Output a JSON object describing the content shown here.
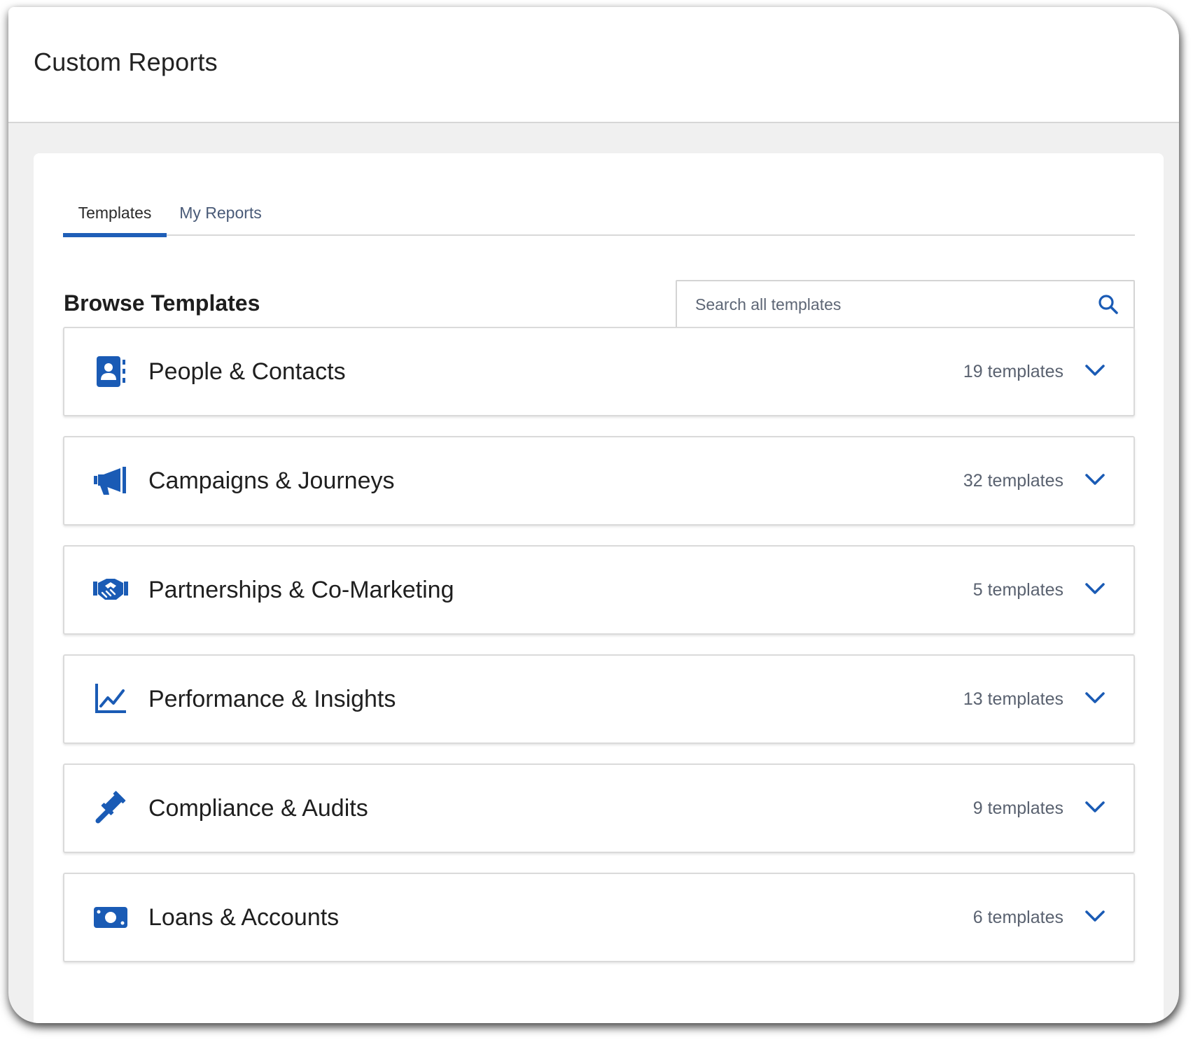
{
  "app": {
    "title": "Custom Reports"
  },
  "tabs": [
    {
      "label": "Templates",
      "active": true
    },
    {
      "label": "My Reports",
      "active": false
    }
  ],
  "browse": {
    "title": "Browse Templates",
    "search": {
      "placeholder": "Search all templates",
      "value": "",
      "icon": "search-icon"
    }
  },
  "categories": [
    {
      "label": "People & Contacts",
      "count": "19 templates",
      "icon": "contact-card-icon"
    },
    {
      "label": "Campaigns & Journeys",
      "count": "32 templates",
      "icon": "megaphone-icon"
    },
    {
      "label": "Partnerships & Co-Marketing",
      "count": "5 templates",
      "icon": "handshake-icon"
    },
    {
      "label": "Performance & Insights",
      "count": "13 templates",
      "icon": "line-chart-icon"
    },
    {
      "label": "Compliance & Audits",
      "count": "9 templates",
      "icon": "gavel-icon"
    },
    {
      "label": "Loans & Accounts",
      "count": "6 templates",
      "icon": "money-bill-icon"
    }
  ],
  "colors": {
    "accent": "#1f5fb8",
    "icon": "#1a5bb5",
    "text": "#1f1f1f",
    "muted": "#5a6270",
    "background": "#f0f0f0"
  }
}
